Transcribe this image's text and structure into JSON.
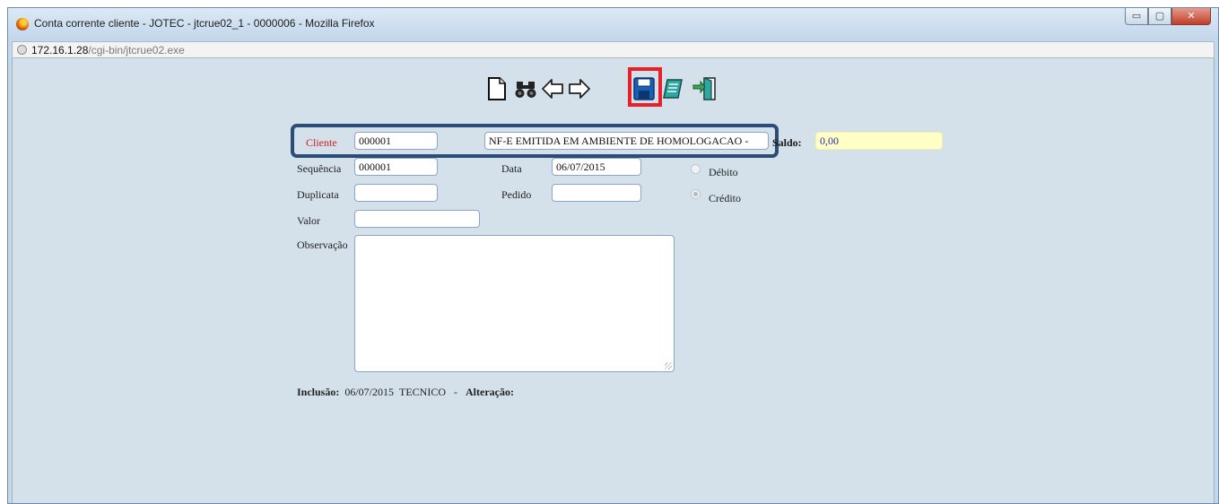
{
  "window": {
    "title": "Conta corrente cliente - JOTEC - jtcrue02_1 - 0000006 - Mozilla Firefox",
    "controls": {
      "minimize": "▭",
      "maximize": "▢",
      "close": "✕"
    }
  },
  "address_bar": {
    "host": "172.16.1.28",
    "path": "/cgi-bin/jtcrue02.exe"
  },
  "toolbar": {
    "icons": [
      "new-document-icon",
      "binoculars-search-icon",
      "arrow-left-icon",
      "arrow-right-icon",
      "save-floppy-icon",
      "edit-notepad-icon",
      "exit-door-icon"
    ],
    "highlight_color": "#e8202a"
  },
  "form": {
    "cliente": {
      "label": "Cliente",
      "code": "000001",
      "name": "NF-E EMITIDA EM AMBIENTE DE HOMOLOGACAO -"
    },
    "saldo": {
      "label": "Saldo:",
      "value": "0,00"
    },
    "sequencia": {
      "label": "Sequência",
      "value": "000001"
    },
    "data": {
      "label": "Data",
      "value": "06/07/2015"
    },
    "duplicata": {
      "label": "Duplicata",
      "value": ""
    },
    "pedido": {
      "label": "Pedido",
      "value": ""
    },
    "valor": {
      "label": "Valor",
      "value": ""
    },
    "observacao": {
      "label": "Observação",
      "value": ""
    },
    "tipo": {
      "debito_label": "Débito",
      "credito_label": "Crédito",
      "selected": "Crédito"
    }
  },
  "footer": {
    "inclusao_label": "Inclusão:",
    "inclusao_date": "06/07/2015",
    "inclusao_user": "TECNICO",
    "separator": "-",
    "alteracao_label": "Alteração:"
  },
  "colors": {
    "client_highlight": "#2c4d76",
    "cliente_label": "#d42020",
    "saldo_bg": "#ffffc6",
    "content_bg": "#d4e0ea"
  }
}
